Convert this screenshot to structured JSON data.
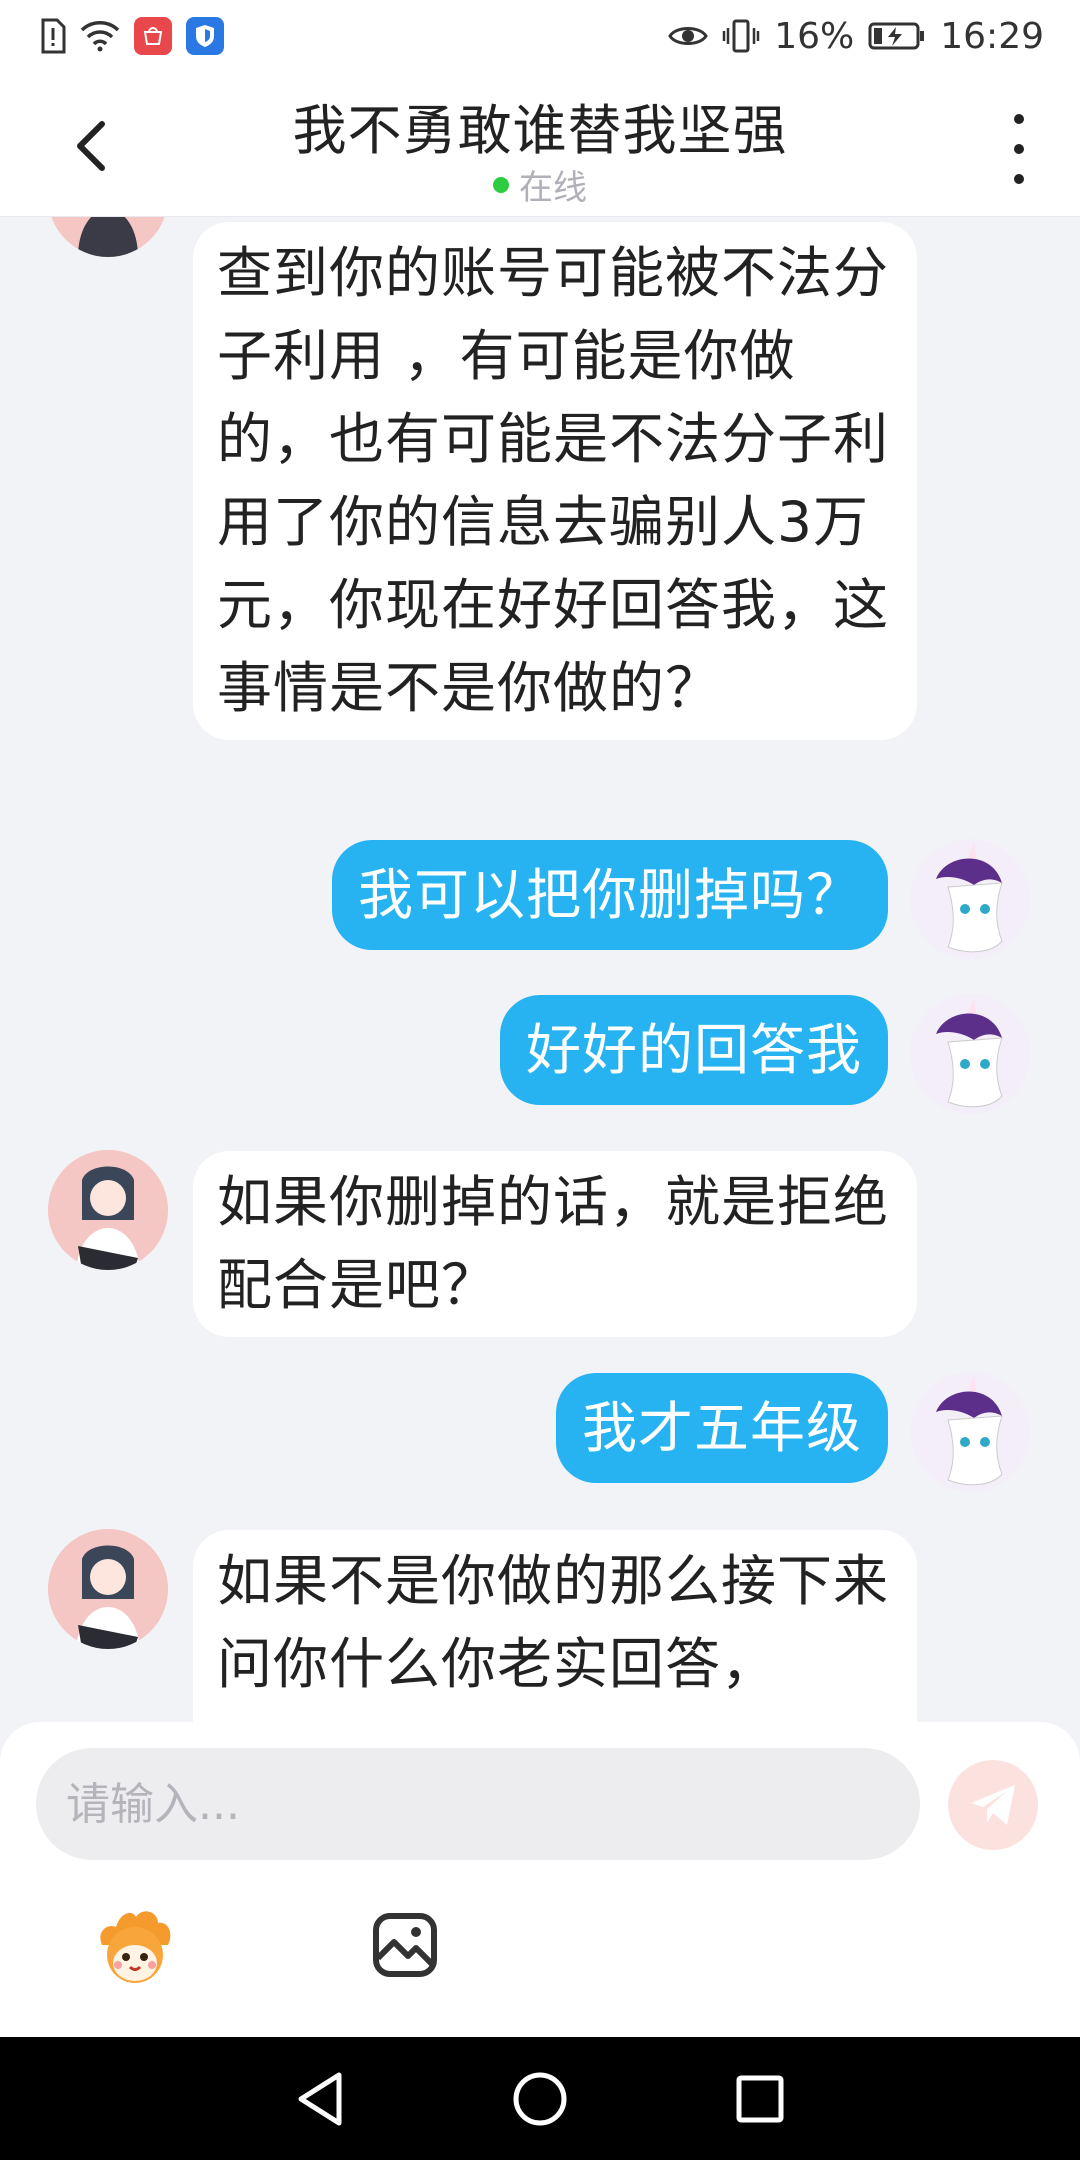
{
  "status_bar": {
    "battery": "16%",
    "time": "16:29"
  },
  "header": {
    "title": "我不勇敢谁替我坚强",
    "status": "在线"
  },
  "messages": [
    {
      "side": "in",
      "text": "查到你的账号可能被不法分子利用 ，有可能是你做的，也有可能是不法分子利用了你的信息去骗别人3万元，你现在好好回答我，这事情是不是你做的？"
    },
    {
      "side": "out",
      "text": "我可以把你删掉吗？"
    },
    {
      "side": "out",
      "text": "好好的回答我"
    },
    {
      "side": "in",
      "text": "如果你删掉的话，就是拒绝配合是吧？"
    },
    {
      "side": "out",
      "text": "我才五年级"
    },
    {
      "side": "in",
      "text": "如果不是你做的那么接下来问你什么你老实回答，"
    }
  ],
  "input": {
    "placeholder": "请输入..."
  },
  "colors": {
    "outgoing_bubble": "#27b3f2",
    "incoming_bubble": "#ffffff",
    "online_dot": "#2ecc40"
  }
}
